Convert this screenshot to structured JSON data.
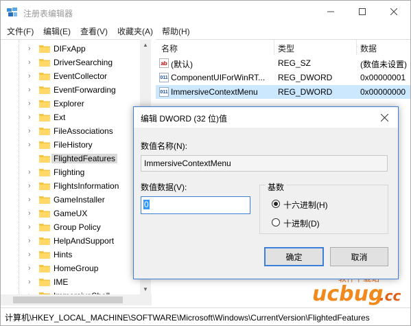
{
  "window": {
    "title": "注册表编辑器"
  },
  "menu": [
    "文件(F)",
    "编辑(E)",
    "查看(V)",
    "收藏夹(A)",
    "帮助(H)"
  ],
  "tree": {
    "items": [
      {
        "label": "DIFxApp",
        "expandable": true
      },
      {
        "label": "DriverSearching",
        "expandable": true
      },
      {
        "label": "EventCollector",
        "expandable": true
      },
      {
        "label": "EventForwarding",
        "expandable": true
      },
      {
        "label": "Explorer",
        "expandable": true
      },
      {
        "label": "Ext",
        "expandable": true
      },
      {
        "label": "FileAssociations",
        "expandable": true
      },
      {
        "label": "FileHistory",
        "expandable": true
      },
      {
        "label": "FlightedFeatures",
        "expandable": false,
        "selected": true
      },
      {
        "label": "Flighting",
        "expandable": true
      },
      {
        "label": "FlightsInformation",
        "expandable": true
      },
      {
        "label": "GameInstaller",
        "expandable": true
      },
      {
        "label": "GameUX",
        "expandable": true
      },
      {
        "label": "Group Policy",
        "expandable": true
      },
      {
        "label": "HelpAndSupport",
        "expandable": true
      },
      {
        "label": "Hints",
        "expandable": true
      },
      {
        "label": "HomeGroup",
        "expandable": true
      },
      {
        "label": "IME",
        "expandable": true
      },
      {
        "label": "ImmersiveShell",
        "expandable": true
      }
    ]
  },
  "list": {
    "columns": [
      "名称",
      "类型",
      "数据"
    ],
    "rows": [
      {
        "icon": "string-value-icon",
        "name": "(默认)",
        "type": "REG_SZ",
        "data": "(数值未设置)"
      },
      {
        "icon": "dword-value-icon",
        "name": "ComponentUIForWinRT...",
        "type": "REG_DWORD",
        "data": "0x00000001"
      },
      {
        "icon": "dword-value-icon",
        "name": "ImmersiveContextMenu",
        "type": "REG_DWORD",
        "data": "0x00000000",
        "selected": true
      }
    ]
  },
  "status": {
    "path": "计算机\\HKEY_LOCAL_MACHINE\\SOFTWARE\\Microsoft\\Windows\\CurrentVersion\\FlightedFeatures"
  },
  "dialog": {
    "title": "编辑 DWORD (32 位)值",
    "name_label": "数值名称(N):",
    "name_value": "ImmersiveContextMenu",
    "data_label": "数值数据(V):",
    "data_value": "0",
    "base_label": "基数",
    "hex_label": "十六进制(H)",
    "dec_label": "十进制(D)",
    "base_selected": "hex",
    "ok_label": "确定",
    "cancel_label": "取消"
  },
  "watermark": {
    "top": "软件下载站",
    "brand": "ucbug",
    "suffix": ".cc"
  },
  "colors": {
    "selection": "#cce8ff",
    "accent": "#3c7fd9",
    "folder": "#f4c542"
  }
}
